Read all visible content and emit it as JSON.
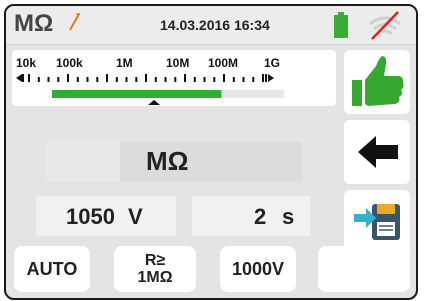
{
  "header": {
    "mode_label": "MΩ",
    "datetime": "14.03.2016 16:34"
  },
  "scale": {
    "ticks": [
      "10k",
      "100k",
      "1M",
      "10M",
      "100M",
      "1G"
    ],
    "bar_fill_fraction": 0.73
  },
  "measurement": {
    "unit": "MΩ"
  },
  "params": {
    "voltage_value": "1050",
    "voltage_unit": "V",
    "time_value": "2",
    "time_unit": "s"
  },
  "buttons": {
    "auto_label": "AUTO",
    "r_line1": "R≥",
    "r_line2": "1MΩ",
    "test_voltage_label": "1000V"
  },
  "icons": {
    "result": "thumbs-up-icon",
    "back": "back-arrow-icon",
    "save": "save-to-memory-icon"
  },
  "colors": {
    "bar": "#2fae2f",
    "battery": "#3cab3c",
    "thumb": "#37a82f",
    "wifi_slash": "#e02020"
  }
}
